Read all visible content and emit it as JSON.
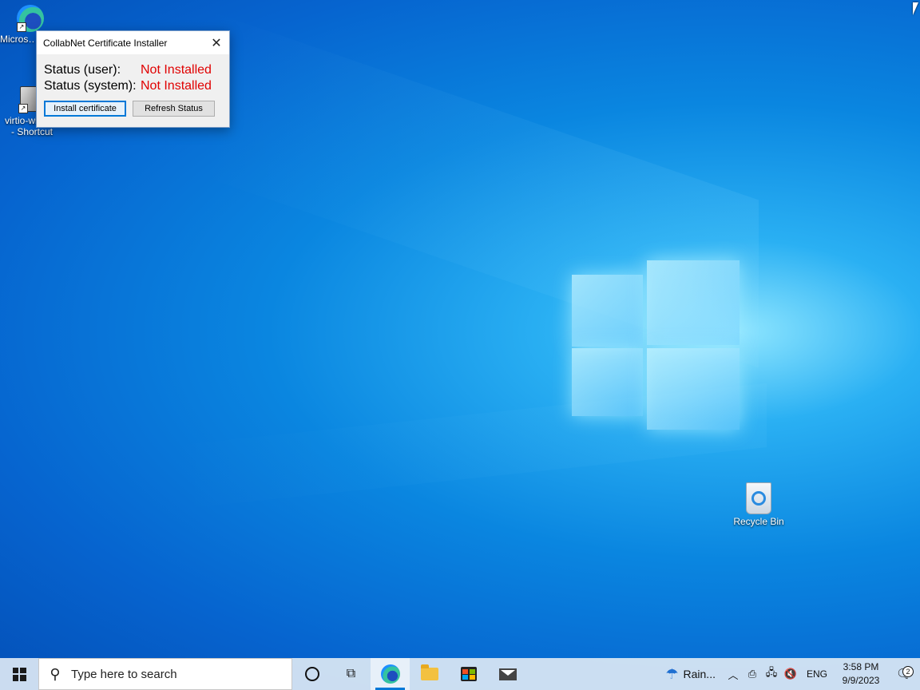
{
  "desktop": {
    "icons": [
      {
        "label": "Microsoft Edge",
        "icon": "edge-icon"
      },
      {
        "label": "virtio-win-g... - Shortcut",
        "icon": "installer-icon"
      },
      {
        "label": "Recycle Bin",
        "icon": "recycle-bin-icon"
      }
    ],
    "edge_label_visible": "Micros… Edg…",
    "virtio_line1": "virtio-win-g...",
    "virtio_line2": "- Shortcut"
  },
  "dialog": {
    "title": "CollabNet Certificate Installer",
    "close_glyph": "✕",
    "status_user_label": "Status (user):",
    "status_user_value": "Not Installed",
    "status_system_label": "Status (system):",
    "status_system_value": "Not Installed",
    "install_button": "Install certificate",
    "refresh_button": "Refresh Status",
    "status_color": "#e00000"
  },
  "taskbar": {
    "search_placeholder": "Type here to search",
    "apps": [
      "cortana-icon",
      "task-view-icon",
      "edge-icon",
      "file-explorer-icon",
      "store-icon",
      "mail-icon"
    ],
    "weather": "Rain...",
    "language": "ENG",
    "time": "3:58 PM",
    "date": "9/9/2023",
    "notification_count": "2"
  }
}
